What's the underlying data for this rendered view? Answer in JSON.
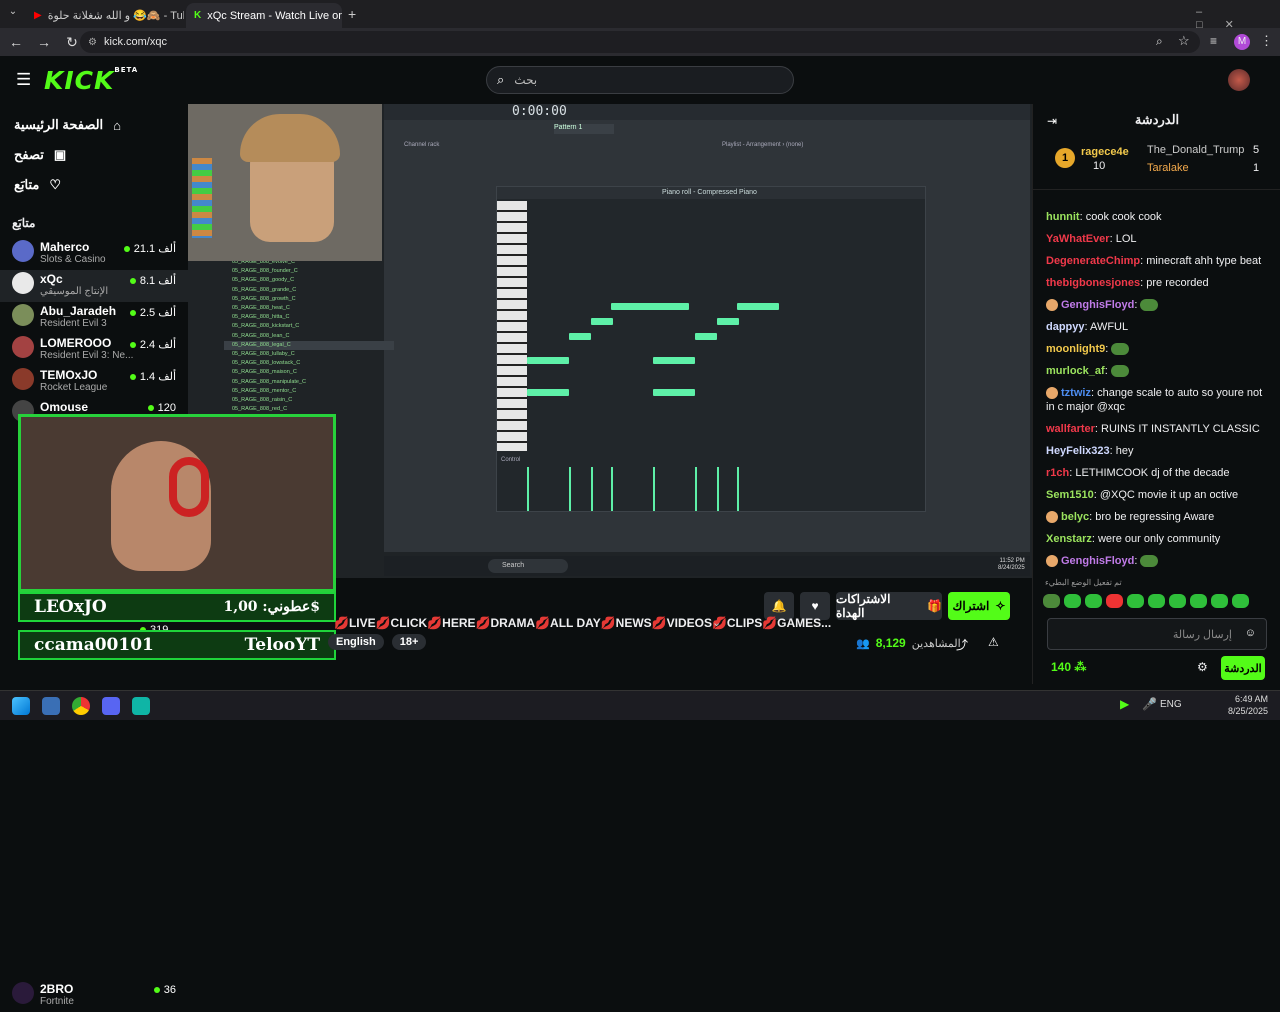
{
  "browser": {
    "tabs": [
      {
        "label": "و الله شغلانة حلوة 😂🙈 - Tube"
      },
      {
        "label": "xQc Stream - Watch Live on"
      }
    ],
    "url": "kick.com/xqc",
    "profile_initial": "M"
  },
  "header": {
    "logo": "KICK",
    "logo_sup": "BETA",
    "search_placeholder": "بحث"
  },
  "nav": {
    "home": "الصفحة الرئيسية",
    "browse": "تصفح",
    "following": "متابَع"
  },
  "sidebar": {
    "section_title": "متابَع",
    "channels": [
      {
        "name": "Maherco",
        "category": "Slots & Casino",
        "viewers": "21.1 ألف"
      },
      {
        "name": "xQc",
        "category": "الإنتاج الموسيقي",
        "viewers": "8.1 ألف"
      },
      {
        "name": "Abu_Jaradeh",
        "category": "Resident Evil 3",
        "viewers": "2.5 ألف"
      },
      {
        "name": "LOMEROOO",
        "category": "Resident Evil 3: Ne...",
        "viewers": "2.4 ألف"
      },
      {
        "name": "TEMOxJO",
        "category": "Rocket League",
        "viewers": "1.4 ألف"
      },
      {
        "name": "Omouse",
        "category": "",
        "viewers": "120"
      },
      {
        "name": "",
        "category": "",
        "viewers": "319"
      },
      {
        "name": "2BRO",
        "category": "Fortnite",
        "viewers": "36"
      }
    ]
  },
  "overlay": {
    "top_name": "LEOxJO",
    "top_amount": "عطوني: 1,00$",
    "bottom_name": "ccama00101",
    "bottom_name2": "TelooYT"
  },
  "daw": {
    "time": "0:00:00",
    "pattern": "Pattern 1",
    "piano_roll_title": "Piano roll - Compressed Piano",
    "playlist": "Playlist - Arrangement › (none)",
    "channel_rack": "Channel rack",
    "control_label": "Control",
    "taskbar_search": "Search",
    "taskbar_time": "11:52 PM",
    "taskbar_date": "8/24/2025",
    "files": [
      "05_RAGE_808_evolve_C",
      "05_RAGE_808_founder_C",
      "05_RAGE_808_goody_C",
      "05_RAGE_808_grande_C",
      "05_RAGE_808_growth_C",
      "05_RAGE_808_heat_C",
      "05_RAGE_808_hitta_C",
      "05_RAGE_808_kickstart_C",
      "05_RAGE_808_lean_C",
      "05_RAGE_808_legal_C",
      "05_RAGE_808_lullaby_C",
      "05_RAGE_808_lowstack_C",
      "05_RAGE_808_maison_C",
      "05_RAGE_808_manipulate_C",
      "05_RAGE_808_mentor_C",
      "05_RAGE_808_raisin_C",
      "05_RAGE_808_red_C"
    ]
  },
  "stream": {
    "title": "💋LIVE💋CLICK💋HERE💋DRAMA💋ALL DAY💋NEWS💋VIDEOS💋CLIPS💋GAMES...",
    "tags": [
      "English",
      "18+"
    ],
    "viewers_label": "المشاهدين",
    "viewers": "8,129",
    "subscribe": "اشتراك",
    "gift_subs": "الاشتراكات الهداة"
  },
  "chat": {
    "title": "الدردشة",
    "leaders": [
      {
        "name": "ragece4e",
        "value": "10"
      },
      {
        "name": "The_Donald_Trump",
        "value": "5"
      },
      {
        "name": "Taralake",
        "value": "1"
      }
    ],
    "messages": [
      {
        "user": "hunnit",
        "color": "#9be35e",
        "text": "cook cook cook"
      },
      {
        "user": "YaWhatEver",
        "color": "#f0394a",
        "text": "LOL"
      },
      {
        "user": "DegenerateChimp",
        "color": "#f0394a",
        "text": "minecraft ahh type beat"
      },
      {
        "user": "thebigbonesjones",
        "color": "#f0394a",
        "text": "pre recorded"
      },
      {
        "user": "GenghisFloyd",
        "color": "#c07be8",
        "text": ""
      },
      {
        "user": "dappyy",
        "color": "#cfd9ff",
        "text": "AWFUL"
      },
      {
        "user": "moonlight9",
        "color": "#f2c94c",
        "text": ""
      },
      {
        "user": "murlock_af",
        "color": "#9be35e",
        "text": ""
      },
      {
        "user": "tztwiz",
        "color": "#4d8df0",
        "text": "change scale to auto so youre not in c major @xqc"
      },
      {
        "user": "wallfarter",
        "color": "#f0394a",
        "text": "RUINS IT INSTANTLY CLASSIC"
      },
      {
        "user": "HeyFelix323",
        "color": "#cfd9ff",
        "text": "hey"
      },
      {
        "user": "r1ch",
        "color": "#f0394a",
        "text": "LETHIMCOOK dj of the decade"
      },
      {
        "user": "Sem1510",
        "color": "#9be35e",
        "text": "@XQC movie it up an octive"
      },
      {
        "user": "belyc",
        "color": "#9be35e",
        "text": "bro be regressing Aware"
      },
      {
        "user": "Xenstarz",
        "color": "#9be35e",
        "text": "were our only community"
      },
      {
        "user": "GenghisFloyd",
        "color": "#c07be8",
        "text": ""
      }
    ],
    "slow_mode": "تم تفعيل الوضع البطيء",
    "input_placeholder": "إرسال رسالة",
    "points": "140",
    "chat_button": "الدردشة"
  },
  "os": {
    "lang": "ENG",
    "time": "6:49 AM",
    "date": "8/25/2025"
  }
}
